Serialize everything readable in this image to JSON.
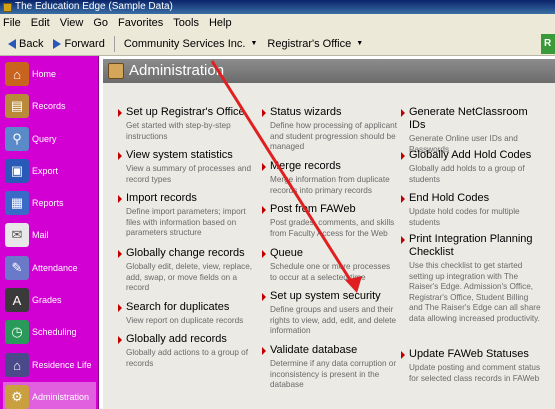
{
  "window": {
    "title": "The Education Edge (Sample Data)"
  },
  "menu": [
    "File",
    "Edit",
    "View",
    "Go",
    "Favorites",
    "Tools",
    "Help"
  ],
  "toolbar": {
    "back": "Back",
    "forward": "Forward",
    "nav1": "Community Services Inc.",
    "nav2": "Registrar's Office",
    "right_button": "R"
  },
  "sidebar": {
    "items": [
      {
        "label": "Home",
        "icon": "home-icon"
      },
      {
        "label": "Records",
        "icon": "records-icon"
      },
      {
        "label": "Query",
        "icon": "query-icon"
      },
      {
        "label": "Export",
        "icon": "export-icon"
      },
      {
        "label": "Reports",
        "icon": "reports-icon"
      },
      {
        "label": "Mail",
        "icon": "mail-icon"
      },
      {
        "label": "Attendance",
        "icon": "attendance-icon"
      },
      {
        "label": "Grades",
        "icon": "grades-icon"
      },
      {
        "label": "Scheduling",
        "icon": "scheduling-icon"
      },
      {
        "label": "Residence Life",
        "icon": "residence-icon"
      },
      {
        "label": "Administration",
        "icon": "administration-icon"
      }
    ]
  },
  "header": {
    "title": "Administration"
  },
  "columns": [
    [
      {
        "title": "Set up Registrar's Office",
        "desc": "Get started with step-by-step instructions"
      },
      {
        "title": "View system statistics",
        "desc": "View a summary of processes and record types"
      },
      {
        "title": "Import records",
        "desc": "Define import parameters; import files with information based on parameters structure"
      },
      {
        "title": "Globally change records",
        "desc": "Globally edit, delete, view, replace, add, swap, or move fields on a record"
      },
      {
        "title": "Search for duplicates",
        "desc": "View report on duplicate records"
      },
      {
        "title": "Globally add records",
        "desc": "Globally add actions to a group of records"
      }
    ],
    [
      {
        "title": "Status wizards",
        "desc": "Define how processing of applicant and student progression should be managed"
      },
      {
        "title": "Merge records",
        "desc": "Merge information from duplicate records into primary records"
      },
      {
        "title": "Post from FAWeb",
        "desc": "Post grades, comments, and skills from Faculty Access for the Web"
      },
      {
        "title": "Queue",
        "desc": "Schedule one or more processes to occur at a selected time"
      },
      {
        "title": "Set up system security",
        "desc": "Define groups and users and their rights to view, add, edit, and delete information"
      },
      {
        "title": "Validate database",
        "desc": "Determine if any data corruption or inconsistency is present in the database"
      }
    ],
    [
      {
        "title": "Generate NetClassroom IDs",
        "desc": "Generate Online user IDs and Passwords"
      },
      {
        "title": "Globally Add Hold Codes",
        "desc": "Globally add holds to a group of students"
      },
      {
        "title": "End Hold Codes",
        "desc": "Update hold codes for multiple students"
      },
      {
        "title": "Print Integration Planning Checklist",
        "desc": "Use this checklist to get started setting up integration with The Raiser's Edge. Admission's Office, Registrar's Office, Student Billing and The Raiser's Edge can all share data allowing increased productivity."
      },
      {
        "title": "Update FAWeb Statuses",
        "desc": "Update posting and comment status for selected class records in FAWeb"
      }
    ]
  ],
  "colors": {
    "sidebar": "#d300d3",
    "bullet": "#c00000",
    "annotation_arrow": "#e02020"
  }
}
